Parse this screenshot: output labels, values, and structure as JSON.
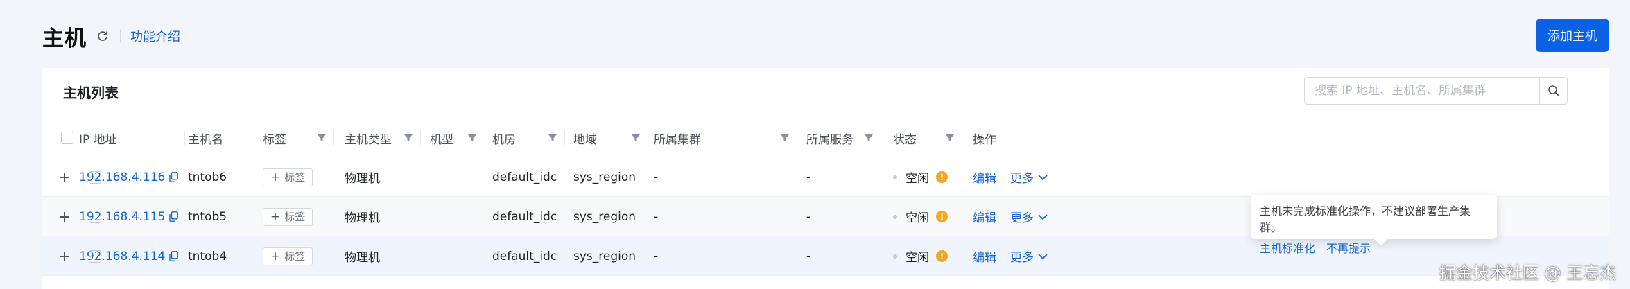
{
  "header": {
    "title": "主机",
    "intro_link": "功能介绍",
    "add_button": "添加主机"
  },
  "card": {
    "title": "主机列表",
    "search_placeholder": "搜索 IP 地址、主机名、所属集群"
  },
  "columns": [
    "IP 地址",
    "主机名",
    "标签",
    "主机类型",
    "机型",
    "机房",
    "地域",
    "所属集群",
    "所属服务",
    "状态",
    "操作"
  ],
  "tag_button_label": "标签",
  "rows": [
    {
      "ip": "192.168.4.116",
      "hostname": "tntob6",
      "type": "物理机",
      "model": "",
      "idc": "default_idc",
      "region": "sys_region",
      "cluster": "-",
      "service": "-",
      "status": "空闲",
      "edit": "编辑",
      "more": "更多"
    },
    {
      "ip": "192.168.4.115",
      "hostname": "tntob5",
      "type": "物理机",
      "model": "",
      "idc": "default_idc",
      "region": "sys_region",
      "cluster": "-",
      "service": "-",
      "status": "空闲",
      "edit": "编辑",
      "more": "更多"
    },
    {
      "ip": "192.168.4.114",
      "hostname": "tntob4",
      "type": "物理机",
      "model": "",
      "idc": "default_idc",
      "region": "sys_region",
      "cluster": "-",
      "service": "-",
      "status": "空闲",
      "edit": "编辑",
      "more": "更多"
    }
  ],
  "tooltip": {
    "message": "主机未完成标准化操作，不建议部署生产集群。",
    "link_standardize": "主机标准化",
    "link_dismiss": "不再提示"
  },
  "watermark": "掘金技术社区 @ 王忘杰",
  "colors": {
    "primary": "#0a61e6",
    "link": "#1464d2",
    "warning": "#f5a623"
  }
}
